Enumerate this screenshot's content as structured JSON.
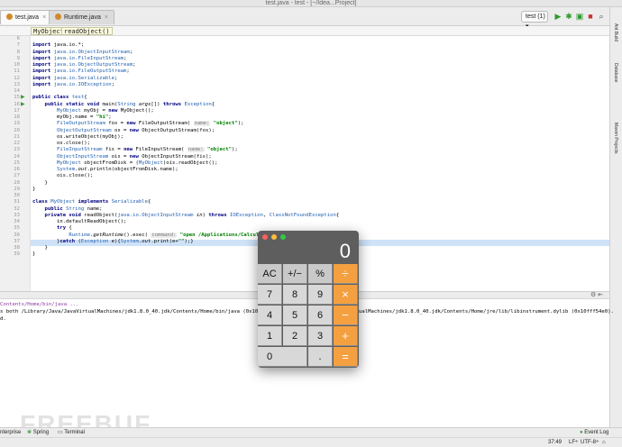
{
  "titlebar": {
    "title": "test.java - test - [~/Idea...Project]"
  },
  "tabs": [
    {
      "label": "test.java",
      "active": true
    },
    {
      "label": "Runtime.java",
      "active": false
    }
  ],
  "toolbar": {
    "run_config": "test (1)"
  },
  "breadcrumb": [
    "MyObject",
    "readObject()"
  ],
  "editor": {
    "lines": [
      {
        "n": "6",
        "html": ""
      },
      {
        "n": "7",
        "html": "<span class=\"kw\">import</span> java.io.*;"
      },
      {
        "n": "8",
        "html": "<span class=\"kw\">import</span> <span class=\"ty\">java.io.ObjectInputStream</span>;"
      },
      {
        "n": "9",
        "html": "<span class=\"kw\">import</span> <span class=\"ty\">java.io.FileInputStream</span>;"
      },
      {
        "n": "10",
        "html": "<span class=\"kw\">import</span> <span class=\"ty\">java.io.ObjectOutputStream</span>;"
      },
      {
        "n": "11",
        "html": "<span class=\"kw\">import</span> <span class=\"ty\">java.io.FileOutputStream</span>;"
      },
      {
        "n": "12",
        "html": "<span class=\"kw\">import</span> <span class=\"ty\">java.io.Serializable</span>;"
      },
      {
        "n": "13",
        "html": "<span class=\"kw\">import</span> <span class=\"ty\">java.io.IOException</span>;"
      },
      {
        "n": "14",
        "html": ""
      },
      {
        "n": "15",
        "html": "<span class=\"kw\">public class</span> <span class=\"ty\">test</span>{"
      },
      {
        "n": "16",
        "html": "    <span class=\"kw\">public static void</span> main(<span class=\"ty\">String</span> <i>args</i>[]) <span class=\"kw\">throws</span> <span class=\"ty\">Exception</span>{"
      },
      {
        "n": "17",
        "html": "        <span class=\"ty\">MyObject</span> myObj = <span class=\"kw\">new</span> MyObject();"
      },
      {
        "n": "18",
        "html": "        myObj.name = <span class=\"str\">\"hi\"</span>;"
      },
      {
        "n": "19",
        "html": "        <span class=\"ty\">FileOutputStream</span> fos = <span class=\"kw\">new</span> FileOutputStream( <span class=\"hint\">name:</span> <span class=\"str\">\"object\"</span>);"
      },
      {
        "n": "20",
        "html": "        <span class=\"ty\">ObjectOutputStream</span> os = <span class=\"kw\">new</span> ObjectOutputStream(fos);"
      },
      {
        "n": "21",
        "html": "        os.writeObject(myObj);"
      },
      {
        "n": "22",
        "html": "        os.close();"
      },
      {
        "n": "23",
        "html": "        <span class=\"ty\">FileInputStream</span> fis = <span class=\"kw\">new</span> FileInputStream( <span class=\"hint\">name:</span> <span class=\"str\">\"object\"</span>);"
      },
      {
        "n": "24",
        "html": "        <span class=\"ty\">ObjectInputStream</span> ois = <span class=\"kw\">new</span> ObjectInputStream(fis);"
      },
      {
        "n": "25",
        "html": "        <span class=\"ty\">MyObject</span> objectFromDisk = (<span class=\"ty\">MyObject</span>)ois.readObject();"
      },
      {
        "n": "26",
        "html": "        <span class=\"ty\">System</span>.<i>out</i>.println(objectFromDisk.name);"
      },
      {
        "n": "27",
        "html": "        ois.close();"
      },
      {
        "n": "28",
        "html": "    }"
      },
      {
        "n": "29",
        "html": "}"
      },
      {
        "n": "30",
        "html": ""
      },
      {
        "n": "31",
        "html": "<span class=\"kw\">class</span> <span class=\"ty\">MyObject</span> <span class=\"kw\">implements</span> <span class=\"ty\">Serializable</span>{"
      },
      {
        "n": "32",
        "html": "    <span class=\"kw\">public</span> <span class=\"ty\">String</span> name;"
      },
      {
        "n": "33",
        "html": "    <span class=\"kw\">private void</span> readObject(<span class=\"ty\">java.io.ObjectInputStream</span> <i>in</i>) <span class=\"kw\">throws</span> <span class=\"ty\">IOException</span>, <span class=\"ty\">ClassNotFoundException</span>{"
      },
      {
        "n": "34",
        "html": "        in.defaultReadObject();"
      },
      {
        "n": "35",
        "html": "        <span class=\"kw\">try</span> {"
      },
      {
        "n": "36",
        "html": "            <span class=\"ty\">Runtime</span>.<i>getRuntime</i>().exec( <span class=\"hint\">command:</span> <span class=\"str\">\"open /Applications/Calculat</span>"
      },
      {
        "n": "37",
        "html": "        }<span class=\"kw\">catch</span> (<span class=\"ty\">Exception</span> e){<span class=\"ty\">System</span>.<i>out</i>.print(e+<span class=\"str\">\"\"</span>);}"
      },
      {
        "n": "38",
        "html": "    }"
      },
      {
        "n": "39",
        "html": "}"
      }
    ]
  },
  "right_tools": [
    "Ant Build",
    "Database",
    "Maven Projects"
  ],
  "console": {
    "lines": [
      "Contents/Home/bin/java ...",
      "s both /Library/Java/JavaVirtualMachines/jdk1.8.0_40.jdk/Contents/Home/bin/java (0x10ef…",
      "ualMachines/jdk1.8.0_40.jdk/Contents/Home/jre/lib/libinstrument.dylib (0x10fff54e0).",
      "d."
    ]
  },
  "bottom_tabs": [
    "nterprise",
    "Spring",
    "Terminal"
  ],
  "event_log": "Event Log",
  "status": {
    "position": "37:49",
    "line_sep": "LF÷",
    "encoding": "UTF-8÷"
  },
  "watermark": "FREEBUF",
  "calculator": {
    "display": "0",
    "keys": [
      [
        "AC",
        "+/−",
        "%",
        "÷"
      ],
      [
        "7",
        "8",
        "9",
        "×"
      ],
      [
        "4",
        "5",
        "6",
        "−"
      ],
      [
        "1",
        "2",
        "3",
        "+"
      ],
      [
        "0",
        "",
        ".",
        "="
      ]
    ],
    "accent": "#f5a040"
  }
}
